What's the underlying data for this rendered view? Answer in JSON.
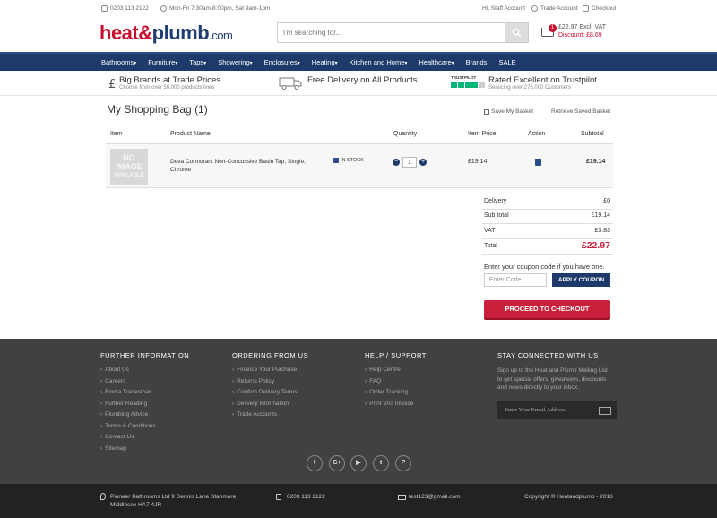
{
  "topbar": {
    "phone": "0203 113 2122",
    "hours": "Mon-Fri 7:30am-8:00pm, Sat 9am-1pm",
    "account": "Hi, Staff Account",
    "trade": "Trade Account",
    "checkout": "Checkout"
  },
  "header": {
    "logo_part1": "heat",
    "logo_amp": "&",
    "logo_part2": "plumb",
    "logo_tld": ".com",
    "search_placeholder": "I'm searching for...",
    "cart_count": "1",
    "cart_price": "£22.97 Excl. VAT",
    "cart_discount": "Discount: £8.69"
  },
  "nav": [
    "Bathrooms",
    "Furniture",
    "Taps",
    "Showering",
    "Enclosures",
    "Heating",
    "Kitchen and Home",
    "Healthcare",
    "Brands",
    "SALE"
  ],
  "nav_dropdown_marker": "▾",
  "usps": [
    {
      "title": "Big Brands at Trade Prices",
      "sub": "Choose from over 50,000 products lines"
    },
    {
      "title": "Free Delivery on All Products",
      "sub": ""
    },
    {
      "title": "Rated Excellent on Trustpilot",
      "sub": "Servicing over 275,000 Customers",
      "badge": "TRUSTPILOT"
    }
  ],
  "bag": {
    "title": "My Shopping Bag (1)",
    "save": "Save My Basket",
    "retrieve": "Retrieve Saved Basket",
    "headers": {
      "item": "Item",
      "product": "Product Name",
      "quantity": "Quantity",
      "price": "Item Price",
      "action": "Action",
      "subtotal": "Subtotal"
    },
    "no_image": {
      "l1": "NO",
      "l2": "IMAGE",
      "l3": "AVAILABLE"
    },
    "product_name": "Deva Cormorant Non-Concussive Basin Tap, Single, Chrome",
    "stock": "IN STOCK",
    "qty": "1",
    "item_price": "£19.14",
    "subtotal": "£19.14"
  },
  "totals": {
    "delivery_label": "Delivery",
    "delivery": "£0",
    "subtotal_label": "Sub total",
    "subtotal": "£19.14",
    "vat_label": "VAT",
    "vat": "£3.83",
    "total_label": "Total",
    "total": "£22.97",
    "coupon_text": "Enter your coupon code if you have one.",
    "coupon_placeholder": "Enter Code",
    "coupon_btn": "APPLY COUPON",
    "checkout_btn": "PROCEED TO CHECKOUT"
  },
  "footer": {
    "col1": {
      "title": "FURTHER INFORMATION",
      "links": [
        "About Us",
        "Careers",
        "Find a Tradesman",
        "Further Reading",
        "Plumbing Advice",
        "Terms & Conditions",
        "Contact Us",
        "Sitemap"
      ]
    },
    "col2": {
      "title": "ORDERING FROM US",
      "links": [
        "Finance Your Purchase",
        "Returns Policy",
        "Confirm Delivery Terms",
        "Delivery Information",
        "Trade Accounts"
      ]
    },
    "col3": {
      "title": "HELP / SUPPORT",
      "links": [
        "Help Centre",
        "FAQ",
        "Order Tracking",
        "Print VAT Invoice"
      ]
    },
    "col4": {
      "title": "STAY CONNECTED WITH US",
      "text": "Sign up to the Heat and Plumb Mailing List to get special offers, giveaways, discounts and news directly to your inbox.",
      "placeholder": "Enter Your Email Address"
    },
    "link_marker": "›",
    "social": [
      "f",
      "G+",
      "▶",
      "t",
      "P"
    ]
  },
  "bottom": {
    "address": "Pioneer Bathrooms Ltd 9 Dennis Lane Stanmore Middlesex HA7 4JR",
    "phone": "0203 113 2122",
    "email": "test123@gmail.com",
    "copyright": "Copyright © Heatandplumb - 2016"
  },
  "colors": {
    "brand_red": "#c8102e",
    "brand_navy": "#1e3a6b",
    "footer_bg": "#414141"
  }
}
